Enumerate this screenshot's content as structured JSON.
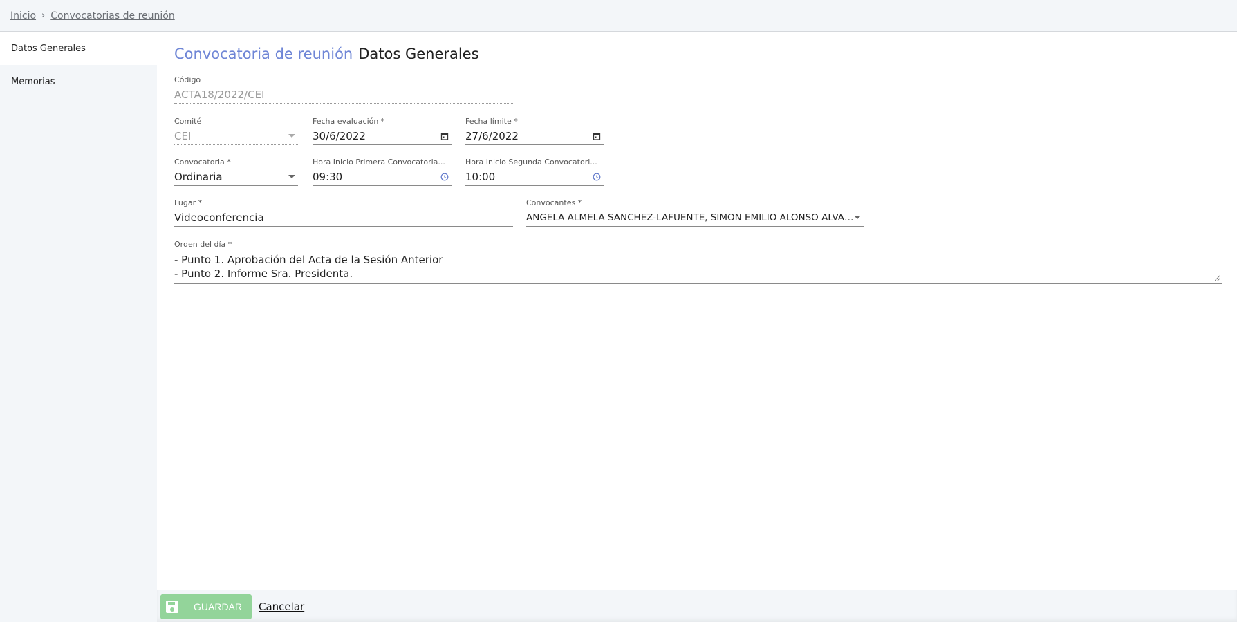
{
  "breadcrumb": {
    "home": "Inicio",
    "separator": "›",
    "current": "Convocatorias de reunión"
  },
  "sidebar": {
    "items": [
      {
        "label": "Datos Generales",
        "active": true
      },
      {
        "label": "Memorias",
        "active": false
      }
    ]
  },
  "title": {
    "section": "Convocatoria de reunión",
    "page": "Datos Generales"
  },
  "form": {
    "codigo": {
      "label": "Código",
      "value": "ACTA18/2022/CEI"
    },
    "comite": {
      "label": "Comité",
      "value": "CEI"
    },
    "fecha_evaluacion": {
      "label": "Fecha evaluación *",
      "value": "30/6/2022"
    },
    "fecha_limite": {
      "label": "Fecha límite *",
      "value": "27/6/2022"
    },
    "convocatoria": {
      "label": "Convocatoria *",
      "value": "Ordinaria"
    },
    "hora_primera": {
      "label": "Hora Inicio Primera Convocatoria...",
      "value": "09:30"
    },
    "hora_segunda": {
      "label": "Hora Inicio Segunda Convocatori...",
      "value": "10:00"
    },
    "lugar": {
      "label": "Lugar *",
      "value": "Videoconferencia"
    },
    "convocantes": {
      "label": "Convocantes *",
      "value": "ANGELA ALMELA SANCHEZ-LAFUENTE, SIMON EMILIO ALONSO ALVARE..."
    },
    "orden_dia": {
      "label": "Orden del día *",
      "lines": [
        "- Punto 1. Aprobación del Acta de la Sesión Anterior",
        "- Punto 2. Informe Sra. Presidenta."
      ]
    }
  },
  "footer": {
    "save_label": "GUARDAR",
    "cancel_label": "Cancelar"
  },
  "colors": {
    "accent": "#6f86d6",
    "save": "#93d49a"
  }
}
